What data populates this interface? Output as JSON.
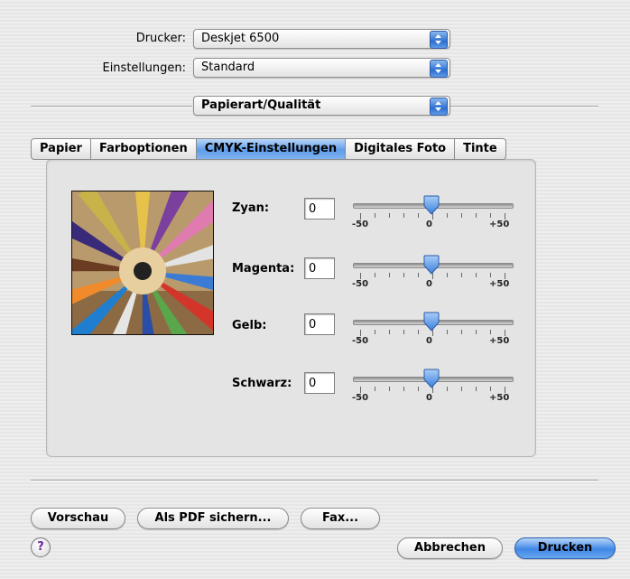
{
  "printer": {
    "label": "Drucker:",
    "value": "Deskjet 6500"
  },
  "settings": {
    "label": "Einstellungen:",
    "value": "Standard"
  },
  "pane": {
    "value": "Papierart/Qualität"
  },
  "tabs": [
    "Papier",
    "Farboptionen",
    "CMYK-Einstellungen",
    "Digitales Foto",
    "Tinte"
  ],
  "active_tab": 2,
  "cmyk": {
    "zyan": {
      "label": "Zyan:",
      "value": "0",
      "level": 0
    },
    "magenta": {
      "label": "Magenta:",
      "value": "0",
      "level": 0
    },
    "gelb": {
      "label": "Gelb:",
      "value": "0",
      "level": 0
    },
    "schwarz": {
      "label": "Schwarz:",
      "value": "0",
      "level": 0
    }
  },
  "scale": {
    "min": "-50",
    "mid": "0",
    "max": "+50"
  },
  "buttons": {
    "preview": "Vorschau",
    "save_pdf": "Als PDF sichern...",
    "fax": "Fax...",
    "cancel": "Abbrechen",
    "print": "Drucken",
    "help": "?"
  },
  "colors": {
    "accent": "#3f87e6",
    "active_tab": "#5f9ceb"
  }
}
